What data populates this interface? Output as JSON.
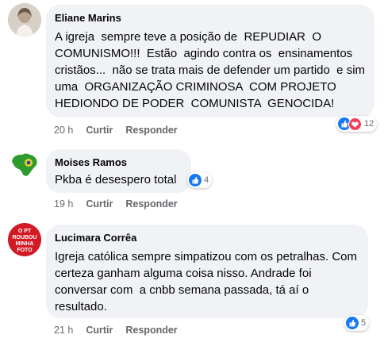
{
  "comments": [
    {
      "author": "Eliane Marins",
      "text": "A igreja  sempre teve a posição de  REPUDIAR  O COMUNISMO!!!  Estão  agindo contra os  ensinamentos cristãos...  não se trata mais de defender um partido  e sim  uma  ORGANIZAÇÃO CRIMINOSA  COM PROJETO HEDIONDO DE PODER  COMUNISTA  GENOCIDA!",
      "time": "20 h",
      "like_label": "Curtir",
      "reply_label": "Responder",
      "reactions": [
        "like-icon",
        "love-icon"
      ],
      "reaction_count": "12"
    },
    {
      "author": "Moises Ramos",
      "text": "Pkba é desespero total",
      "time": "19 h",
      "like_label": "Curtir",
      "reply_label": "Responder",
      "reactions": [
        "like-icon"
      ],
      "reaction_count": "4"
    },
    {
      "author": "Lucimara Corrêa",
      "text": "Igreja católica sempre simpatizou com os petralhas. Com certeza ganham alguma coisa nisso. Andrade foi conversar com  a cnbb semana passada, tá aí o resultado.",
      "time": "21 h",
      "like_label": "Curtir",
      "reply_label": "Responder",
      "reactions": [
        "like-icon"
      ],
      "reaction_count": "5",
      "avatar_text": "O PT ROUBOU MINHA FOTO"
    }
  ],
  "colors": {
    "like": "#1877f2",
    "love": "#f33e58",
    "bubble": "#f0f2f5",
    "meta": "#65676b"
  }
}
